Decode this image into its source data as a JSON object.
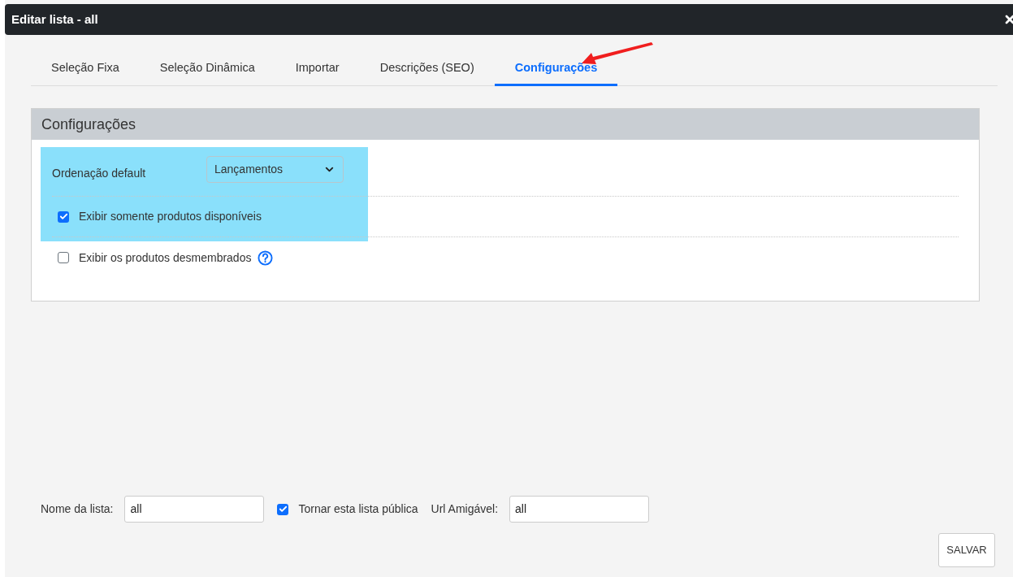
{
  "window": {
    "title": "Editar lista - all"
  },
  "tabs": [
    {
      "label": "Seleção Fixa",
      "selected": false
    },
    {
      "label": "Seleção Dinâmica",
      "selected": false
    },
    {
      "label": "Importar",
      "selected": false
    },
    {
      "label": "Descrições (SEO)",
      "selected": false
    },
    {
      "label": "Configurações",
      "selected": true
    }
  ],
  "panel": {
    "title": "Configurações",
    "sort": {
      "label": "Ordenação default",
      "value": "Lançamentos"
    },
    "options": [
      {
        "label": "Exibir somente produtos disponíveis",
        "checked": true,
        "help": false
      },
      {
        "label": "Exibir os produtos desmembrados",
        "checked": false,
        "help": true
      }
    ]
  },
  "footer": {
    "name_label": "Nome da lista:",
    "name_value": "all",
    "public": {
      "label": "Tornar esta lista pública",
      "checked": true
    },
    "url_label": "Url Amigável:",
    "url_value": "all"
  },
  "buttons": [
    "SALVAR"
  ]
}
